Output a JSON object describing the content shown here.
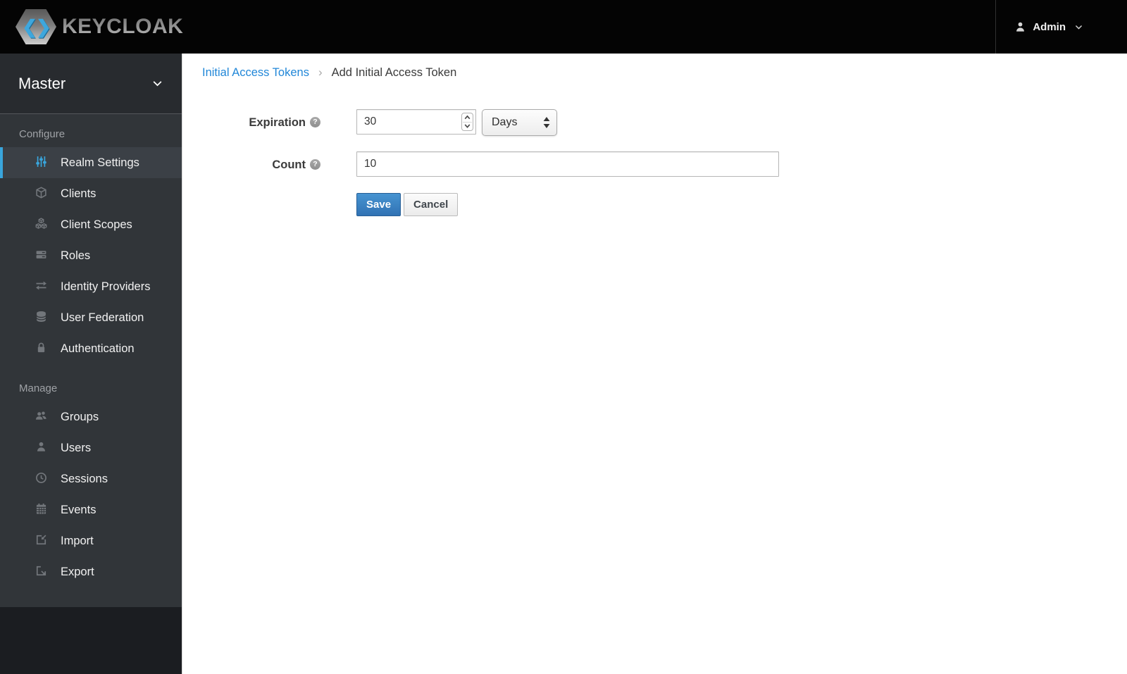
{
  "topbar": {
    "brand": "KEYCLOAK",
    "brand_glyphs": "❮❯",
    "user": {
      "name": "Admin"
    }
  },
  "sidebar": {
    "realm": {
      "name": "Master"
    },
    "sections": [
      {
        "header": "Configure",
        "items": [
          {
            "label": "Realm Settings",
            "icon": "sliders-icon",
            "active": true
          },
          {
            "label": "Clients",
            "icon": "cube-icon",
            "active": false
          },
          {
            "label": "Client Scopes",
            "icon": "cubes-icon",
            "active": false
          },
          {
            "label": "Roles",
            "icon": "server-icon",
            "active": false
          },
          {
            "label": "Identity Providers",
            "icon": "exchange-arrows-icon",
            "active": false
          },
          {
            "label": "User Federation",
            "icon": "database-icon",
            "active": false
          },
          {
            "label": "Authentication",
            "icon": "lock-icon",
            "active": false
          }
        ]
      },
      {
        "header": "Manage",
        "items": [
          {
            "label": "Groups",
            "icon": "group-icon",
            "active": false
          },
          {
            "label": "Users",
            "icon": "user-icon",
            "active": false
          },
          {
            "label": "Sessions",
            "icon": "clock-icon",
            "active": false
          },
          {
            "label": "Events",
            "icon": "calendar-icon",
            "active": false
          },
          {
            "label": "Import",
            "icon": "import-icon",
            "active": false
          },
          {
            "label": "Export",
            "icon": "export-icon",
            "active": false
          }
        ]
      }
    ]
  },
  "breadcrumb": {
    "parent": "Initial Access Tokens",
    "separator": "›",
    "current": "Add Initial Access Token"
  },
  "form": {
    "expiration": {
      "label": "Expiration",
      "help": "?",
      "value": "30",
      "unit_selected": "Days"
    },
    "count": {
      "label": "Count",
      "help": "?",
      "value": "10"
    },
    "buttons": {
      "save": "Save",
      "cancel": "Cancel"
    }
  },
  "colors": {
    "accent_blue": "#39a5dc",
    "link_blue": "#2187d8",
    "topbar_bg": "#040404",
    "sidebar_bg": "#313539",
    "active_item_bg": "#3b4046",
    "primary_button": "#3b83c4",
    "icon_gray": "#72767b"
  }
}
